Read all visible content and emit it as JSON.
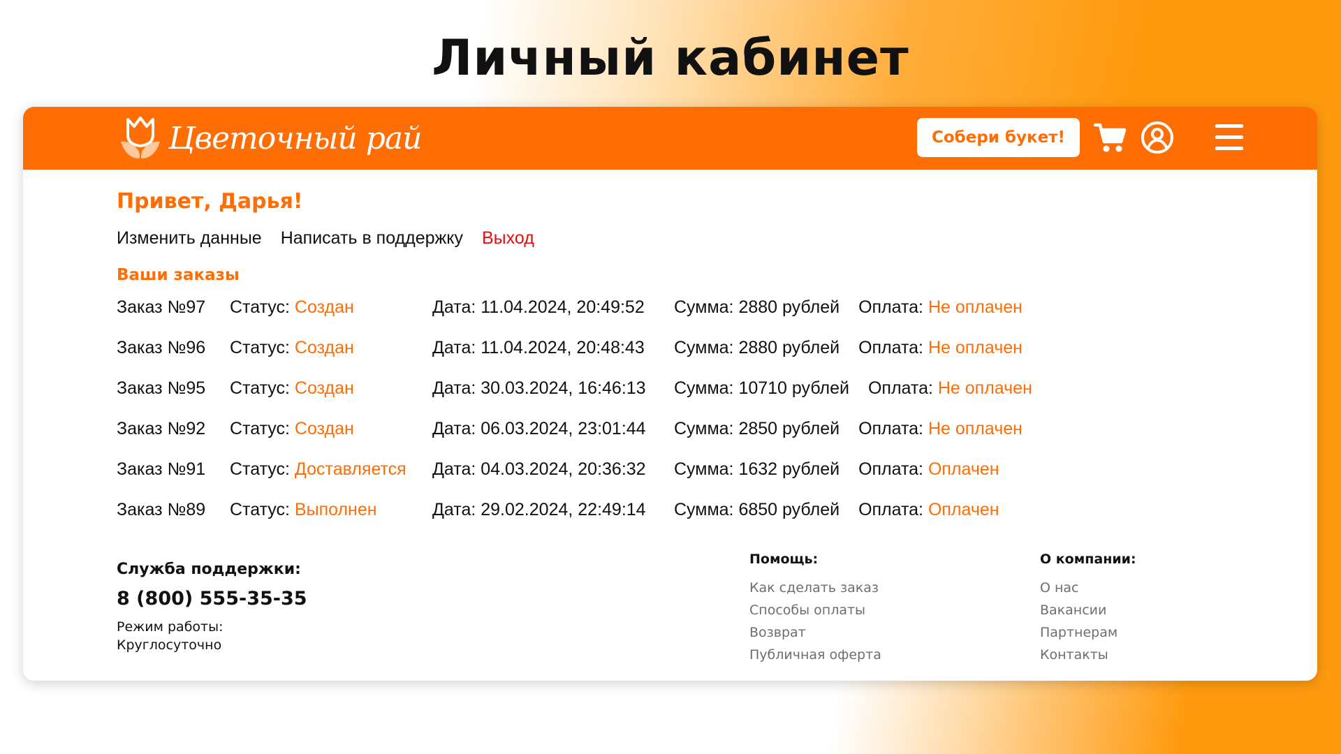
{
  "slide": {
    "title": "Личный кабинет"
  },
  "colors": {
    "accent": "#ff6d05",
    "logout": "#e20f0f",
    "footer_link": "#6e6e6e"
  },
  "header": {
    "logo_text": "Цветочный рай",
    "build_button": "Собери букет!",
    "icons": [
      "cart-icon",
      "user-icon",
      "menu-icon"
    ]
  },
  "account": {
    "greeting": "Привет, Дарья!",
    "actions": {
      "edit": "Изменить данные",
      "support": "Написать в поддержку",
      "logout": "Выход"
    },
    "orders_heading": "Ваши заказы"
  },
  "orders": [
    {
      "number": "Заказ №97",
      "status_label": "Статус: ",
      "status": "Создан",
      "date": "Дата: 11.04.2024, 20:49:52",
      "sum": "Сумма: 2880 рублей",
      "payment_label": "Оплата: ",
      "payment": "Не оплачен"
    },
    {
      "number": "Заказ №96",
      "status_label": "Статус: ",
      "status": "Создан",
      "date": "Дата: 11.04.2024, 20:48:43",
      "sum": "Сумма: 2880 рублей",
      "payment_label": "Оплата: ",
      "payment": "Не оплачен"
    },
    {
      "number": "Заказ №95",
      "status_label": "Статус: ",
      "status": "Создан",
      "date": "Дата: 30.03.2024, 16:46:13",
      "sum": "Сумма: 10710 рублей",
      "payment_label": "Оплата: ",
      "payment": "Не оплачен"
    },
    {
      "number": "Заказ №92",
      "status_label": "Статус: ",
      "status": "Создан",
      "date": "Дата: 06.03.2024, 23:01:44",
      "sum": "Сумма: 2850 рублей",
      "payment_label": "Оплата: ",
      "payment": "Не оплачен"
    },
    {
      "number": "Заказ №91",
      "status_label": "Статус: ",
      "status": "Доставляется",
      "date": "Дата: 04.03.2024, 20:36:32",
      "sum": "Сумма: 1632 рублей",
      "payment_label": "Оплата: ",
      "payment": "Оплачен"
    },
    {
      "number": "Заказ №89",
      "status_label": "Статус: ",
      "status": "Выполнен",
      "date": "Дата: 29.02.2024, 22:49:14",
      "sum": "Сумма: 6850 рублей",
      "payment_label": "Оплата: ",
      "payment": "Оплачен"
    }
  ],
  "footer": {
    "support": {
      "title": "Служба поддержки:",
      "phone": "8 (800) 555-35-35",
      "hours_label": "Режим работы:",
      "hours": "Круглосуточно"
    },
    "help": {
      "title": "Помощь:",
      "links": [
        "Как сделать заказ",
        "Способы оплаты",
        "Возврат",
        "Публичная оферта"
      ]
    },
    "company": {
      "title": "О компании:",
      "links": [
        "О нас",
        "Вакансии",
        "Партнерам",
        "Контакты"
      ]
    }
  }
}
